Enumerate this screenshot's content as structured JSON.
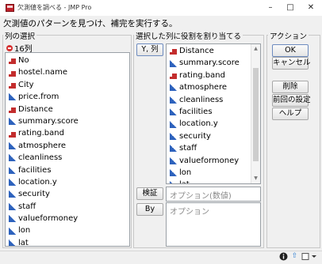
{
  "window": {
    "title": "欠測値を調べる - JMP Pro",
    "minimize_glyph": "–",
    "maximize_glyph": "□",
    "close_glyph": "✕"
  },
  "instruction": "欠測値のパターンを見つけ、補完を実行する。",
  "select_columns": {
    "title": "列の選択",
    "count_label": "16列",
    "items": [
      {
        "label": "No",
        "type": "nominal"
      },
      {
        "label": "hostel.name",
        "type": "nominal"
      },
      {
        "label": "City",
        "type": "nominal"
      },
      {
        "label": "price.from",
        "type": "continuous"
      },
      {
        "label": "Distance",
        "type": "nominal"
      },
      {
        "label": "summary.score",
        "type": "continuous"
      },
      {
        "label": "rating.band",
        "type": "nominal"
      },
      {
        "label": "atmosphere",
        "type": "continuous"
      },
      {
        "label": "cleanliness",
        "type": "continuous"
      },
      {
        "label": "facilities",
        "type": "continuous"
      },
      {
        "label": "location.y",
        "type": "continuous"
      },
      {
        "label": "security",
        "type": "continuous"
      },
      {
        "label": "staff",
        "type": "continuous"
      },
      {
        "label": "valueformoney",
        "type": "continuous"
      },
      {
        "label": "lon",
        "type": "continuous"
      },
      {
        "label": "lat",
        "type": "continuous"
      }
    ]
  },
  "cast_roles": {
    "title": "選択した列に役割を割り当てる",
    "y_button": "Y, 列",
    "y_items": [
      {
        "label": "Distance",
        "type": "nominal"
      },
      {
        "label": "summary.score",
        "type": "continuous"
      },
      {
        "label": "rating.band",
        "type": "nominal"
      },
      {
        "label": "atmosphere",
        "type": "continuous"
      },
      {
        "label": "cleanliness",
        "type": "continuous"
      },
      {
        "label": "facilities",
        "type": "continuous"
      },
      {
        "label": "location.y",
        "type": "continuous"
      },
      {
        "label": "security",
        "type": "continuous"
      },
      {
        "label": "staff",
        "type": "continuous"
      },
      {
        "label": "valueformoney",
        "type": "continuous"
      },
      {
        "label": "lon",
        "type": "continuous"
      },
      {
        "label": "lat",
        "type": "continuous"
      }
    ],
    "validation_button": "検証",
    "validation_placeholder": "オプション(数値)",
    "by_button": "By",
    "by_placeholder": "オプション"
  },
  "actions": {
    "title": "アクション",
    "ok": "OK",
    "cancel": "キャンセル",
    "remove": "削除",
    "recall": "前回の設定",
    "help": "ヘルプ"
  },
  "status_icons": [
    "info-icon",
    "up-arrow-icon",
    "window-menu-icon"
  ],
  "colors": {
    "nominal": "#c32d2d",
    "continuous": "#2d62bd"
  }
}
